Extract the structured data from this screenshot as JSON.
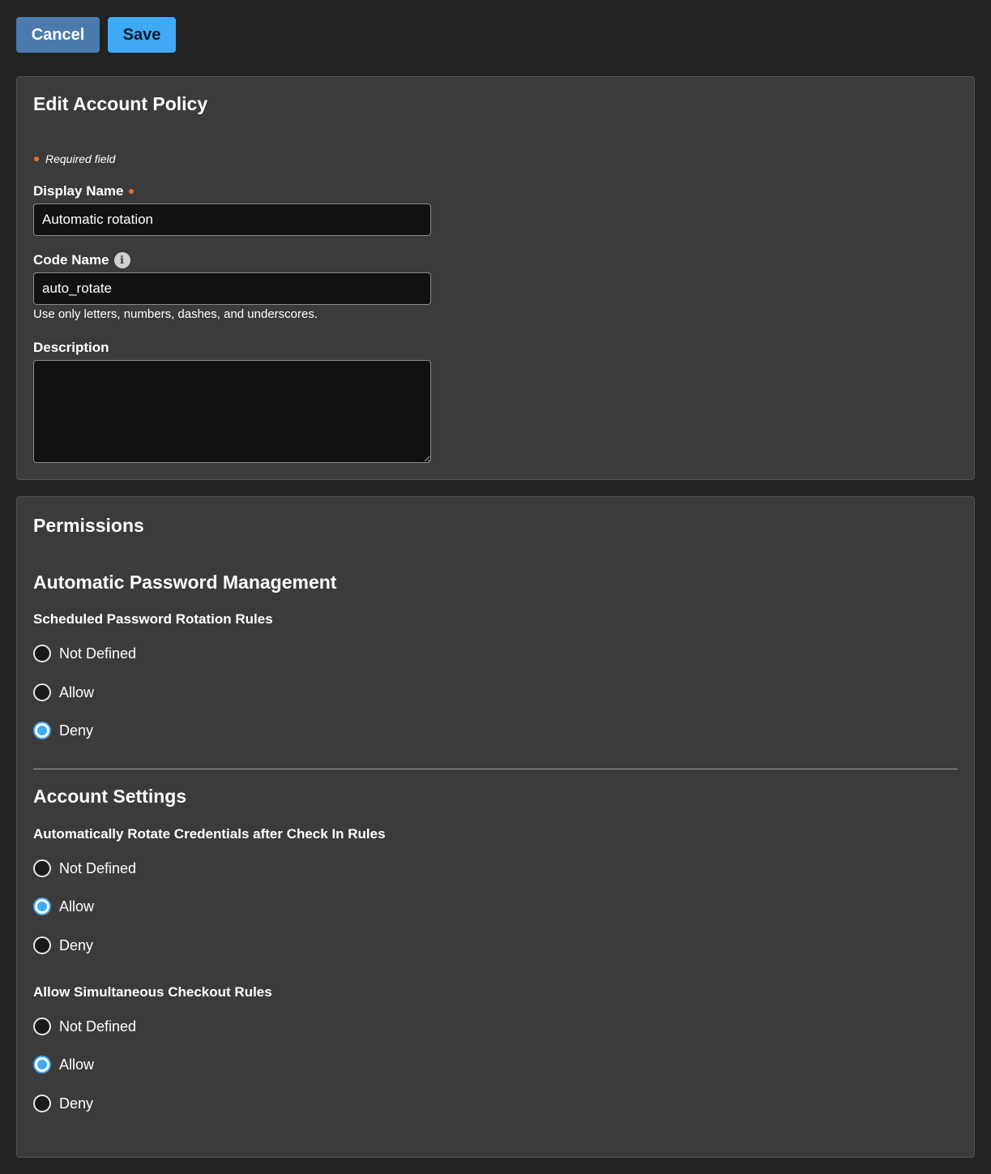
{
  "toolbar": {
    "cancel_label": "Cancel",
    "save_label": "Save"
  },
  "edit": {
    "title": "Edit Account Policy",
    "required_note": "Required field",
    "display_name_label": "Display Name",
    "display_name_value": "Automatic rotation",
    "code_name_label": "Code Name",
    "code_name_value": "auto_rotate",
    "code_name_help": "Use only letters, numbers, dashes, and underscores.",
    "description_label": "Description",
    "description_value": ""
  },
  "permissions": {
    "title": "Permissions",
    "groups": [
      {
        "title": "Automatic Password Management",
        "rules": [
          {
            "label": "Scheduled Password Rotation Rules",
            "options": [
              "Not Defined",
              "Allow",
              "Deny"
            ],
            "selected": "Deny"
          }
        ]
      },
      {
        "title": "Account Settings",
        "rules": [
          {
            "label": "Automatically Rotate Credentials after Check In Rules",
            "options": [
              "Not Defined",
              "Allow",
              "Deny"
            ],
            "selected": "Allow"
          },
          {
            "label": "Allow Simultaneous Checkout Rules",
            "options": [
              "Not Defined",
              "Allow",
              "Deny"
            ],
            "selected": "Allow"
          }
        ]
      }
    ]
  },
  "colors": {
    "accent": "#3fa9f5",
    "required": "#f26b21",
    "cancel": "#4a7aae"
  }
}
